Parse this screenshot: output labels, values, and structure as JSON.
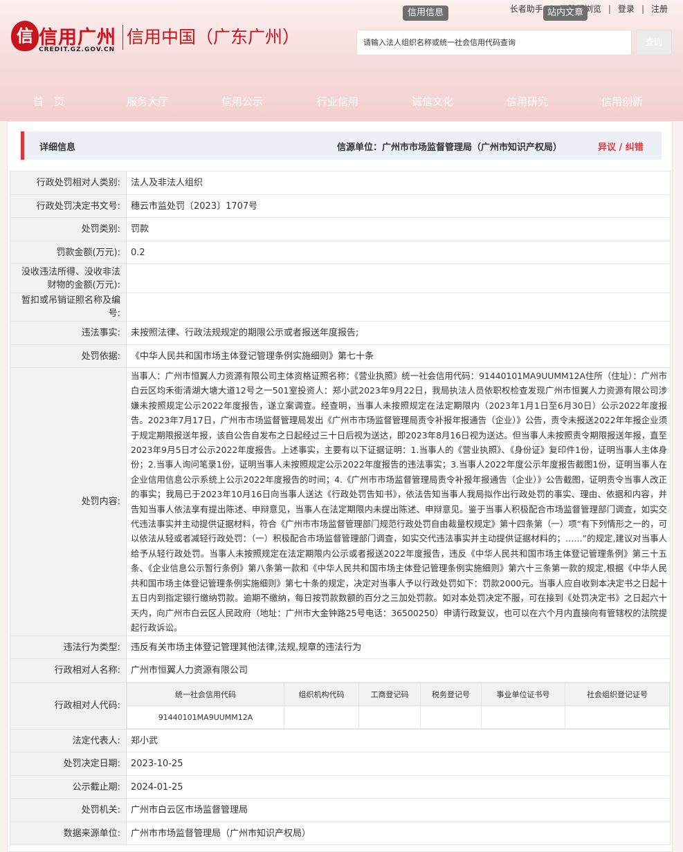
{
  "header": {
    "logo_seal": "信",
    "logo_title": "信用广州",
    "logo_en": "CREDIT.GZ.GOV.CN",
    "site_subtitle": "信用中国（广东广州）",
    "top_links": [
      "长者助手",
      "无障碍浏览",
      "登录",
      "注册"
    ],
    "tab_credit_info": "信用信息",
    "tab_site_article": "站内文章",
    "search_placeholder": "请输入法人组织名称或统一社会信用代码查询",
    "search_button": "查询"
  },
  "nav": [
    "首　页",
    "服务大厅",
    "信用公示",
    "行业信用",
    "诚信文化",
    "信用研究",
    "信用创新"
  ],
  "detail": {
    "title": "详细信息",
    "source": "信源单位：广州市市场监督管理局（广州市知识产权局）",
    "objection": "异议 / 纠错"
  },
  "rows": {
    "party_type": {
      "label": "行政处罚相对人类别:",
      "value": "法人及非法人组织"
    },
    "decision_no": {
      "label": "行政处罚决定书文号:",
      "value": "穗云市监处罚〔2023〕1707号"
    },
    "penalty_type": {
      "label": "处罚类别:",
      "value": "罚款"
    },
    "fine_amount": {
      "label": "罚款金额(万元):",
      "value": "0.2"
    },
    "confiscation": {
      "label": "没收违法所得、没收非法财物的金额(万元):",
      "value": ""
    },
    "license_suspension": {
      "label": "暂扣或吊销证照名称及编号:",
      "value": ""
    },
    "violation_facts": {
      "label": "违法事实:",
      "value": "未按照法律、行政法规规定的期限公示或者报送年度报告;"
    },
    "penalty_basis": {
      "label": "处罚依据:",
      "value": "《中华人民共和国市场主体登记管理条例实施细则》第七十条"
    },
    "penalty_content": {
      "label": "处罚内容:",
      "value": "当事人：广州市恒翼人力资源有限公司主体资格证照名称：《营业执照》统一社会信用代码：91440101MA9UUMM12A住所（住址）：广州市白云区均禾街清湖大塘大道12号之一501室投资人：郑小武2023年9月22日，我局执法人员依职权检查发现广州市恒翼人力资源有限公司涉嫌未按照规定公示2022年度报告，遂立案调查。经查明，当事人未按照规定在法定期限内（2023年1月1日至6月30日）公示2022年度报告。2023年7月17日，广州市市场监督管理局发出《广州市市场监督管理局责令补报年报通告（企业）》公告，责令未报送2022年年报企业须于规定期限报送年报，该自公告自发布之日起经过三十日后视为送达，即2023年8月16日视为送达。但当事人未按照责令期限报送年报，直至2023年9月5日才公示2022年度报告。上述事实，主要有以下证据证明：1.当事人的《营业执照》、《身份证》复印件1份，证明当事人主体身份；2.当事人询问笔录1份，证明当事人未按照规定公示2022年度报告的违法事实；3.当事人2022年度公示年度报告截图1份，证明当事人在企业信用信息公示系统上公示2022年度报告的时间；4.《广州市市场监督管理局责令补报年报通告（企业）》公告截图，证明责令当事人改正的事实；我局已于2023年10月16日向当事人送达《行政处罚告知书》，依法告知当事人我局拟作出行政处罚的事实、理由、依据和内容，并告知当事人依法享有提出陈述、申辩意见，当事人在法定期限内未提出陈述、申辩意见。鉴于当事人积极配合市场监督管理部门调查，如实交代违法事实并主动提供证据材料，符合《广州市市场监督管理部门规范行政处罚自由裁量权规定》第十四条第（一）项“有下列情形之一的，可以依法从轻或者减轻行政处罚：（一）积极配合市场监督管理部门调查，如实交代违法事实并主动提供证据材料的；……”的规定,建议对当事人给予从轻行政处罚。当事人未按照规定在法定期限内公示或者报送2022年度报告，违反《中华人民共和国市场主体登记管理条例》第三十五条、《企业信息公示暂行条例》第八条第一款和《中华人民共和国市场主体登记管理条例实施细则》第六十三条第一款的规定,根据《中华人民共和国市场主体登记管理条例实施细则》第七十条的规定，决定对当事人予以行政处罚如下：罚款2000元。当事人应自收到本决定书之日起十五日内到指定银行缴纳罚款。逾期不缴纳，每日按罚款数额的百分之三加处罚款。如对本处罚决定不服，可在接到《处罚决定书》之日起六十天内，向广州市白云区人民政府（地址：广州市大金钟路25号电话：36500250）申请行政复议，也可以在六个月内直接向有管辖权的法院提起行政诉讼。"
    },
    "violation_type": {
      "label": "违法行为类型:",
      "value": "违反有关市场主体登记管理其他法律,法规,规章的违法行为"
    },
    "party_name": {
      "label": "行政相对人名称:",
      "value": "广州市恒翼人力资源有限公司"
    },
    "party_code": {
      "label": "行政相对人代码:",
      "headers": [
        "统一社会信用代码",
        "组织机构代码",
        "工商登记码",
        "税务登记号",
        "事业单位证书号",
        "社会组织登记证号"
      ],
      "values": [
        "91440101MA9UUMM12A",
        "",
        "",
        "",
        "",
        ""
      ]
    },
    "legal_rep": {
      "label": "法定代表人:",
      "value": "郑小武"
    },
    "decision_date": {
      "label": "处罚决定日期:",
      "value": "2023-10-25"
    },
    "publicity_deadline": {
      "label": "公示截止期:",
      "value": "2024-01-25"
    },
    "penalty_authority": {
      "label": "处罚机关:",
      "value": "广州市白云区市场监督管理局"
    },
    "data_source": {
      "label": "数据来源单位:",
      "value": "广州市市场监督管理局（广州市知识产权局）"
    }
  }
}
